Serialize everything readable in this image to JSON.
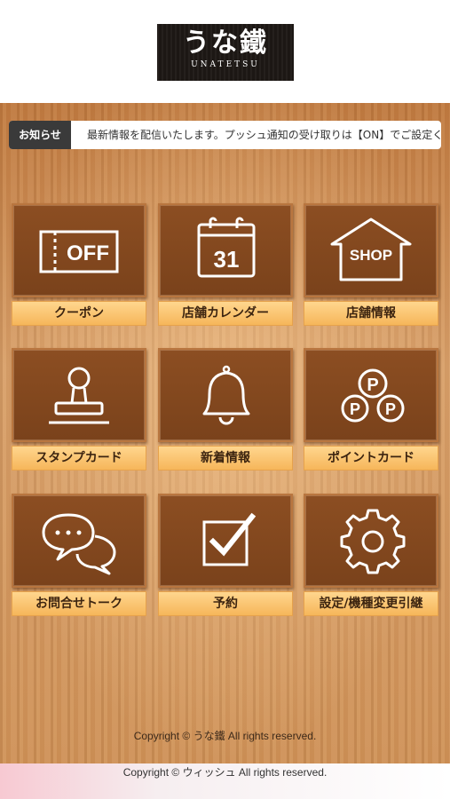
{
  "header": {
    "logo_text": "うな鐵",
    "logo_sub": "UNATETSU"
  },
  "news": {
    "label": "お知らせ",
    "text": "最新情報を配信いたします。プッシュ通知の受け取りは【ON】でご設定ください"
  },
  "menu": [
    {
      "label": "クーポン",
      "icon": "off-coupon-icon",
      "icon_text": "OFF"
    },
    {
      "label": "店舗カレンダー",
      "icon": "calendar-icon",
      "icon_text": "31"
    },
    {
      "label": "店舗情報",
      "icon": "shop-icon",
      "icon_text": "SHOP"
    },
    {
      "label": "スタンプカード",
      "icon": "stamp-icon"
    },
    {
      "label": "新着情報",
      "icon": "bell-icon"
    },
    {
      "label": "ポイントカード",
      "icon": "point-coins-icon",
      "icon_text": "P"
    },
    {
      "label": "お問合せトーク",
      "icon": "chat-bubbles-icon"
    },
    {
      "label": "予約",
      "icon": "checkbox-icon"
    },
    {
      "label": "設定/機種変更引継",
      "icon": "gear-icon"
    }
  ],
  "copyright_shop": "Copyright © うな鐵 All rights reserved.",
  "copyright_footer": "Copyright © ウィッシュ All rights reserved."
}
